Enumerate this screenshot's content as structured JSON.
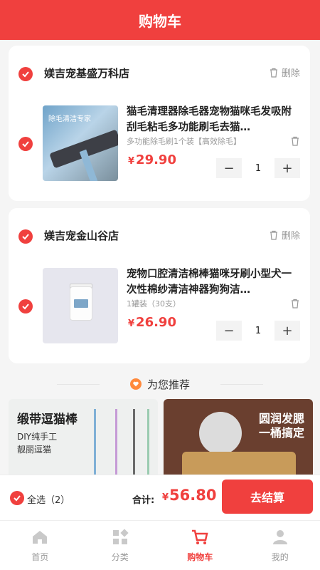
{
  "header": {
    "title": "购物车"
  },
  "accent": "#f0403e",
  "shops": [
    {
      "name": "媄吉宠基盛万科店",
      "delete_label": "删除",
      "item": {
        "thumb_title": "除毛清洁专家",
        "title": "猫毛清理器除毛器宠物猫咪毛发吸附刮毛粘毛多功能刷毛去猫…",
        "spec": "多功能除毛刷1个装【高效除毛】",
        "currency": "¥",
        "price": "29.90",
        "quantity": "1",
        "minus": "−",
        "plus": "+"
      }
    },
    {
      "name": "媄吉宠金山谷店",
      "delete_label": "删除",
      "item": {
        "title": "宠物口腔清洁棉棒猫咪牙刷小型犬一次性棉纱清洁神器狗狗洁…",
        "spec": "1罐装（30支）",
        "currency": "¥",
        "price": "26.90",
        "quantity": "1",
        "minus": "−",
        "plus": "+"
      }
    }
  ],
  "recommend": {
    "title": "为您推荐",
    "cards": [
      {
        "title": "缎带逗猫棒",
        "line1": "DIY纯手工",
        "line2": "靓丽逗猫"
      },
      {
        "title": "圆润发腮",
        "line1": "一桶搞定"
      }
    ]
  },
  "checkout": {
    "select_all": "全选（2）",
    "total_label": "合计:",
    "currency": "¥",
    "total": "56.80",
    "pay_button": "去结算"
  },
  "tabbar": {
    "items": [
      {
        "label": "首页",
        "icon": "home-icon"
      },
      {
        "label": "分类",
        "icon": "category-icon"
      },
      {
        "label": "购物车",
        "icon": "cart-icon",
        "active": true
      },
      {
        "label": "我的",
        "icon": "user-icon"
      }
    ]
  }
}
